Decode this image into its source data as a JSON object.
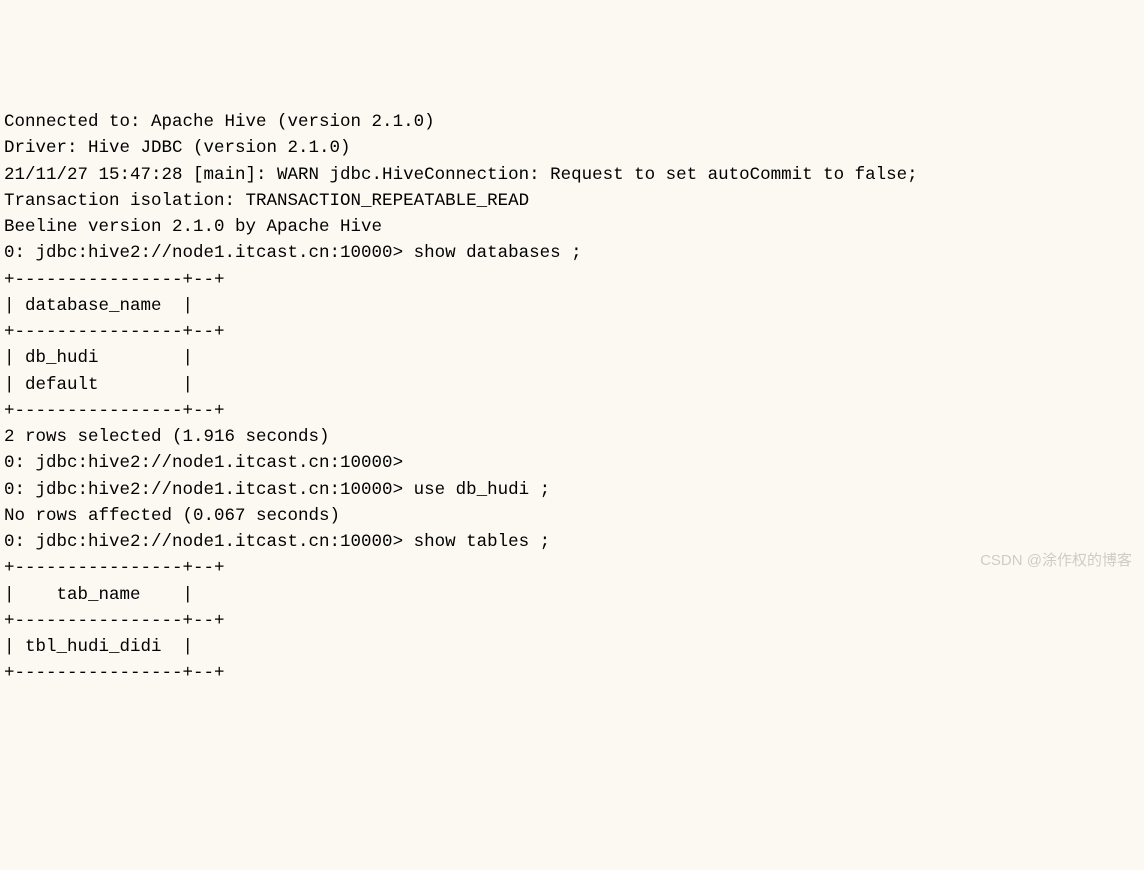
{
  "lines": {
    "l0": "Connected to: Apache Hive (version 2.1.0)",
    "l1": "Driver: Hive JDBC (version 2.1.0)",
    "l2": "21/11/27 15:47:28 [main]: WARN jdbc.HiveConnection: Request to set autoCommit to false;",
    "l3": "Transaction isolation: TRANSACTION_REPEATABLE_READ",
    "l4": "Beeline version 2.1.0 by Apache Hive",
    "l5": "0: jdbc:hive2://node1.itcast.cn:10000> show databases ;",
    "l6": "+----------------+--+",
    "l7": "| database_name  |",
    "l8": "+----------------+--+",
    "l9": "| db_hudi        |",
    "l10": "| default        |",
    "l11": "+----------------+--+",
    "l12": "2 rows selected (1.916 seconds)",
    "l13": "0: jdbc:hive2://node1.itcast.cn:10000>",
    "l14": "0: jdbc:hive2://node1.itcast.cn:10000> use db_hudi ;",
    "l15": "No rows affected (0.067 seconds)",
    "l16": "0: jdbc:hive2://node1.itcast.cn:10000> show tables ;",
    "l17": "+----------------+--+",
    "l18": "|    tab_name    |",
    "l19": "+----------------+--+",
    "l20": "| tbl_hudi_didi  |",
    "l21": "+----------------+--+"
  },
  "watermark": "CSDN @涂作权的博客"
}
